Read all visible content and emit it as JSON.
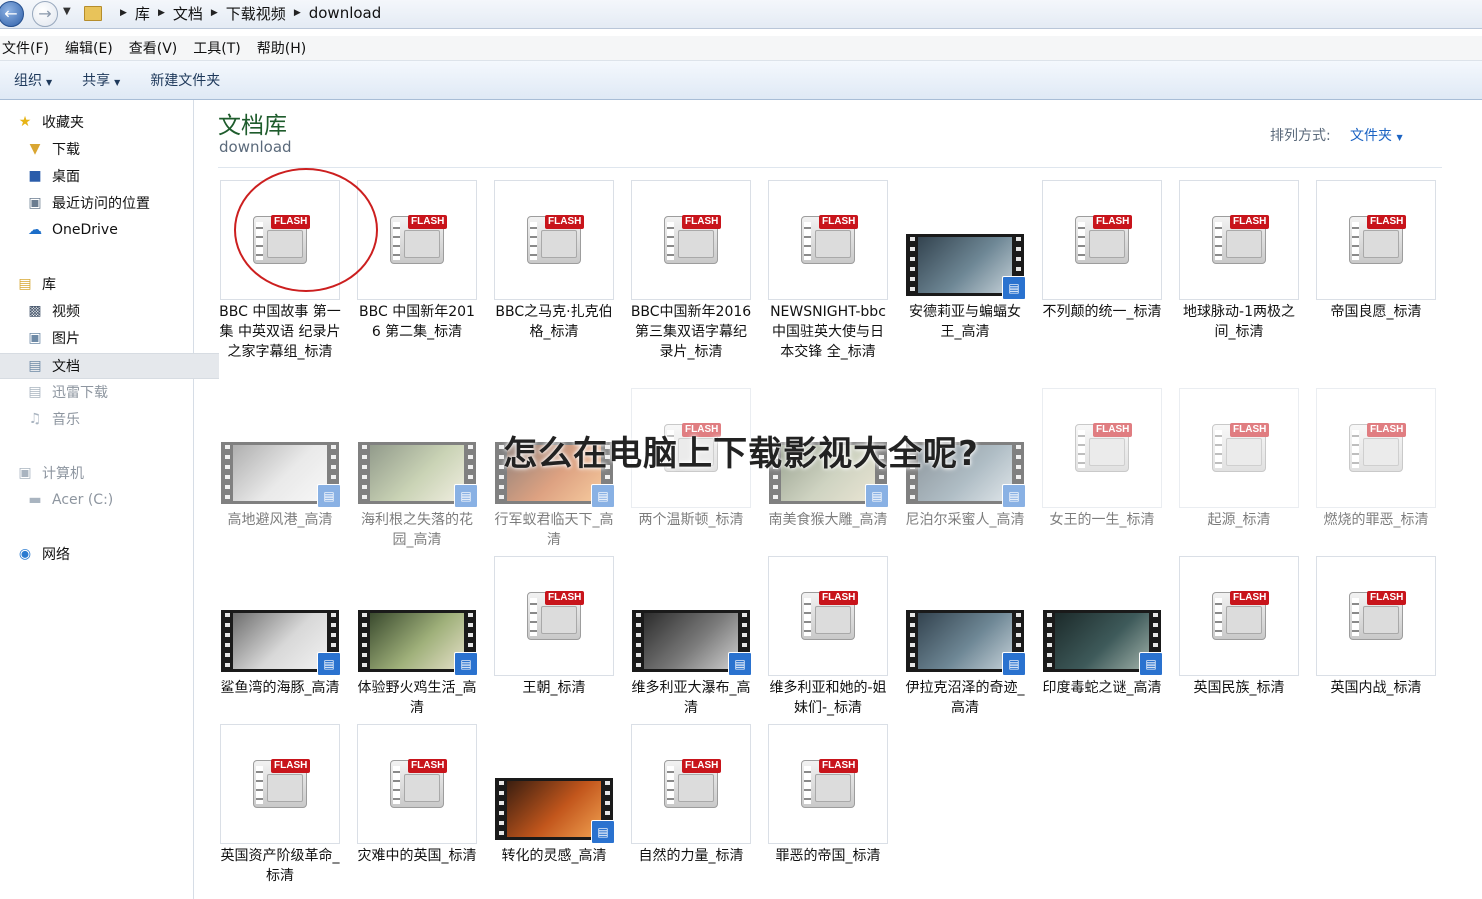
{
  "address": {
    "crumbs": [
      "库",
      "文档",
      "下载视频",
      "download"
    ]
  },
  "menu": [
    "文件(F)",
    "编辑(E)",
    "查看(V)",
    "工具(T)",
    "帮助(H)"
  ],
  "toolbar": {
    "organize": "组织",
    "share": "共享",
    "new_folder": "新建文件夹"
  },
  "sidebar": {
    "favorites": "收藏夹",
    "downloads": "下载",
    "desktop": "桌面",
    "recent": "最近访问的位置",
    "onedrive": "OneDrive",
    "libraries": "库",
    "videos": "视频",
    "pictures": "图片",
    "documents": "文档",
    "thunder": "迅雷下载",
    "music": "音乐",
    "computer": "计算机",
    "drive_c": "Acer (C:)",
    "network": "网络"
  },
  "content": {
    "title": "文档库",
    "subtitle": "download",
    "sort_label": "排列方式:",
    "sort_value": "文件夹"
  },
  "overlay_text": "怎么在电脑上下载影视大全呢?",
  "files": [
    {
      "name": "BBC 中国故事 第一集 中英双语 纪录片之家字幕组_标清",
      "type": "flash"
    },
    {
      "name": "BBC 中国新年2016 第二集_标清",
      "type": "flash"
    },
    {
      "name": "BBC之马克·扎克伯格_标清",
      "type": "flash"
    },
    {
      "name": "BBC中国新年2016第三集双语字幕纪录片_标清",
      "type": "flash"
    },
    {
      "name": "NEWSNIGHT-bbc 中国驻英大使与日本交锋 全_标清",
      "type": "flash"
    },
    {
      "name": "安德莉亚与蝙蝠女王_高清",
      "type": "video"
    },
    {
      "name": "不列颠的统一_标清",
      "type": "flash"
    },
    {
      "name": "地球脉动-1两极之间_标清",
      "type": "flash"
    },
    {
      "name": "帝国良愿_标清",
      "type": "flash"
    },
    {
      "name": "高地避风港_高清",
      "type": "video"
    },
    {
      "name": "海利根之失落的花园_高清",
      "type": "video"
    },
    {
      "name": "行军蚁君临天下_高清",
      "type": "video"
    },
    {
      "name": "两个温斯顿_标清",
      "type": "flash"
    },
    {
      "name": "南美食猴大雕_高清",
      "type": "video"
    },
    {
      "name": "尼泊尔采蜜人_高清",
      "type": "video"
    },
    {
      "name": "女王的一生_标清",
      "type": "flash"
    },
    {
      "name": "起源_标清",
      "type": "flash"
    },
    {
      "name": "燃烧的罪恶_标清",
      "type": "flash"
    },
    {
      "name": "鲨鱼湾的海豚_高清",
      "type": "video"
    },
    {
      "name": "体验野火鸡生活_高清",
      "type": "video"
    },
    {
      "name": "王朝_标清",
      "type": "flash"
    },
    {
      "name": "维多利亚大瀑布_高清",
      "type": "video"
    },
    {
      "name": "维多利亚和她的-姐妹们-_标清",
      "type": "flash"
    },
    {
      "name": "伊拉克沼泽的奇迹_高清",
      "type": "video"
    },
    {
      "name": "印度毒蛇之谜_高清",
      "type": "video"
    },
    {
      "name": "英国民族_标清",
      "type": "flash"
    },
    {
      "name": "英国内战_标清",
      "type": "flash"
    },
    {
      "name": "英国资产阶级革命_标清",
      "type": "flash"
    },
    {
      "name": "灾难中的英国_标清",
      "type": "flash"
    },
    {
      "name": "转化的灵感_高清",
      "type": "video"
    },
    {
      "name": "自然的力量_标清",
      "type": "flash"
    },
    {
      "name": "罪恶的帝国_标清",
      "type": "flash"
    }
  ],
  "colors": {
    "title_green": "#1e5c2c",
    "link_blue": "#1b63c3",
    "flash_red": "#c8141b",
    "highlight_circle": "#cc1f1f"
  }
}
